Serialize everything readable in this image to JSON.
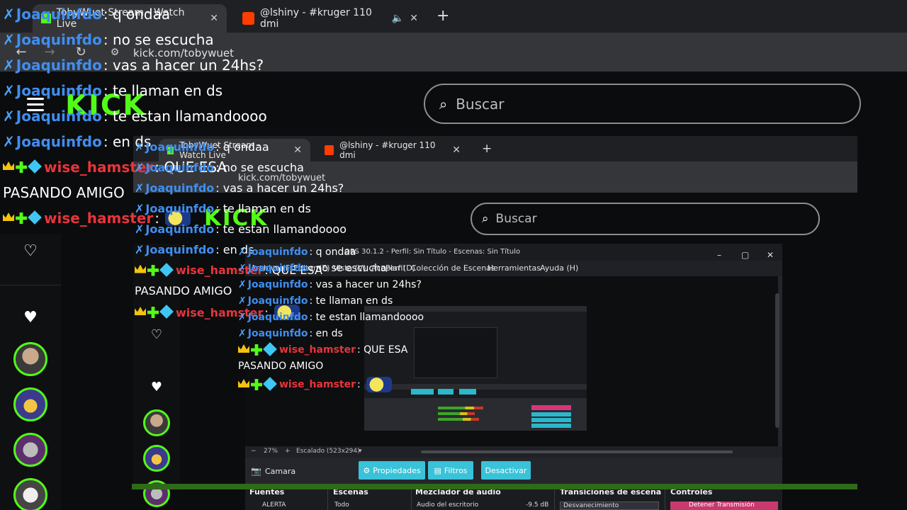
{
  "browser": {
    "tabs": [
      {
        "title": "TobyWuet Stream - Watch Live",
        "icon": "kick-tab-icon",
        "active": true
      },
      {
        "title": "@lshiny - #kruger 110 dmi",
        "icon": "soundcloud-tab-icon",
        "active": false
      }
    ],
    "new_tab": "+",
    "close_glyph": "✕",
    "address": "kick.com/tobywuet"
  },
  "kick": {
    "logo": "KICK",
    "search_placeholder": "Buscar"
  },
  "chat": {
    "lines": [
      {
        "user": "Joaquinfdo",
        "text": ": q ondaa",
        "style": "blue"
      },
      {
        "user": "Joaquinfdo",
        "text": ": no se escucha",
        "style": "blue"
      },
      {
        "user": "Joaquinfdo",
        "text": ": vas a hacer un 24hs?",
        "style": "blue"
      },
      {
        "user": "Joaquinfdo",
        "text": ": te llaman en ds",
        "style": "blue"
      },
      {
        "user": "Joaquinfdo",
        "text": ": te estan llamandoooo",
        "style": "blue"
      },
      {
        "user": "Joaquinfdo",
        "text": ": en ds",
        "style": "blue"
      },
      {
        "user": "wise_hamster",
        "text": ": QUE ESA",
        "style": "red"
      },
      {
        "user": "",
        "text": "PASANDO AMIGO",
        "style": "plain"
      },
      {
        "user": "wise_hamster",
        "text": ":",
        "style": "red"
      }
    ]
  },
  "obs": {
    "title": "OBS 30.1.2 - Perfil: Sin Título - Escenas: Sin Título",
    "menu": [
      "Archivo (F)",
      "Editar (E)",
      "Vista (V)",
      "Acoplar (D)",
      "Perfil",
      "Colección de Escenas",
      "Herramientas",
      "Ayuda (H)"
    ],
    "status": {
      "zoom": "27%",
      "scaling": "Escalado (523x294)"
    },
    "source_label": "Camara",
    "buttons": {
      "properties": "Propiedades",
      "filters": "Filtros",
      "deactivate": "Desactivar"
    },
    "docks": {
      "sources": "Fuentes",
      "scenes": "Escenas",
      "mixer": "Mezclador de audio",
      "transitions": "Transiciones de escena",
      "controls": "Controles"
    },
    "rows": {
      "source_item": "ALERTA",
      "scene_item": "Todo",
      "mixer_item": "Audio del escritorio",
      "mixer_db": "-9.5 dB",
      "transition_item": "Desvanecimiento",
      "control_item": "Detener Transmisión"
    }
  },
  "colors": {
    "kick_green": "#53fc18",
    "obs_cyan": "#39c2d8",
    "chat_blue": "#3f8ef0",
    "chat_red": "#e7353b"
  }
}
